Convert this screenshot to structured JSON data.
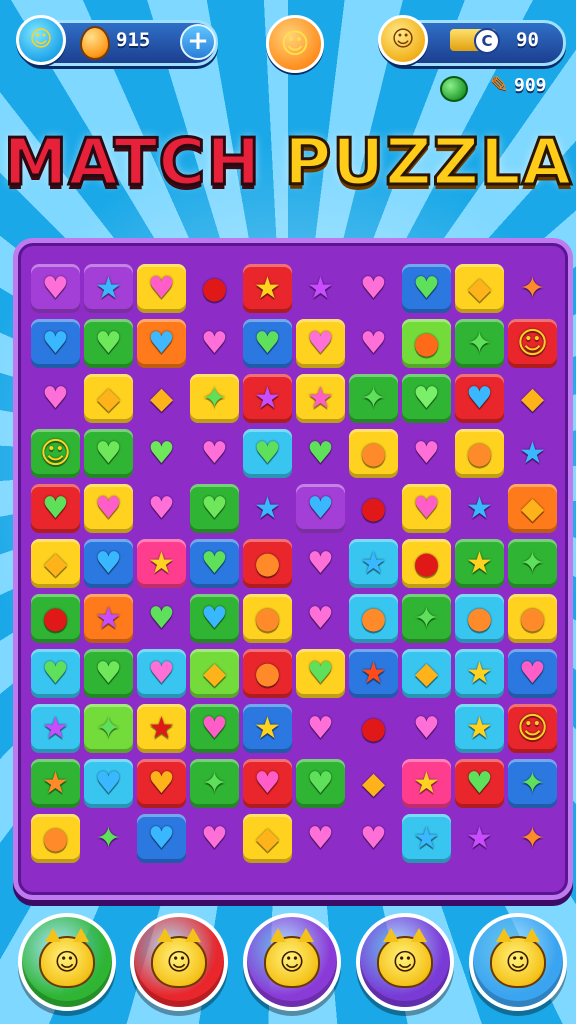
{
  "title": {
    "part1": "MATCH",
    "part2": "PUZZLA"
  },
  "hud": {
    "coins_value": "915",
    "plus_label": "+",
    "right_value": "90",
    "right_icon_label": "C",
    "carrot_count": "909"
  },
  "colors": {
    "red": "#e8262b",
    "green": "#2fb533",
    "blue": "#2b78e0",
    "yellow": "#ffd21f",
    "orange": "#ff7a1a",
    "purple": "#a33fd6",
    "lime": "#74dc3a",
    "cyan": "#38c6f0",
    "pink": "#ff3d8f"
  },
  "board": {
    "rows": [
      [
        [
          "purple",
          "♥",
          "#ff6fd8"
        ],
        [
          "purple",
          "★",
          "#39b8ff"
        ],
        [
          "yellow",
          "♥",
          "#ff5ec8"
        ],
        [
          "none",
          "●",
          "#e01818"
        ],
        [
          "red",
          "★",
          "#ffd21f"
        ],
        [
          "none",
          "★",
          "#c84dff"
        ],
        [
          "none",
          "♥",
          "#ff6fd8"
        ],
        [
          "blue",
          "♥",
          "#5ee05a"
        ],
        [
          "yellow",
          "◆",
          "#ffb31a"
        ],
        [
          "none",
          "✦",
          "#ff8a2a"
        ]
      ],
      [
        [
          "blue",
          "♥",
          "#39b8ff"
        ],
        [
          "green",
          "♥",
          "#6ee85a"
        ],
        [
          "orange",
          "♥",
          "#3fb8ff"
        ],
        [
          "none",
          "♥",
          "#ff6fd8"
        ],
        [
          "blue",
          "♥",
          "#5ee05a"
        ],
        [
          "yellow",
          "♥",
          "#ff6fd8"
        ],
        [
          "none",
          "♥",
          "#ff6fd8"
        ],
        [
          "lime",
          "●",
          "#ff6a1a"
        ],
        [
          "green",
          "✦",
          "#5ee05a"
        ],
        [
          "red",
          "☺",
          "#ffd21f"
        ]
      ],
      [
        [
          "none",
          "♥",
          "#ff6fd8"
        ],
        [
          "yellow",
          "◆",
          "#ffb31a"
        ],
        [
          "none",
          "◆",
          "#ffb31a"
        ],
        [
          "yellow",
          "✦",
          "#5ee05a"
        ],
        [
          "red",
          "★",
          "#c84dff"
        ],
        [
          "yellow",
          "★",
          "#ff5ec8"
        ],
        [
          "green",
          "✦",
          "#5ee05a"
        ],
        [
          "green",
          "♥",
          "#7af06a"
        ],
        [
          "red",
          "♥",
          "#39b8ff"
        ],
        [
          "none",
          "◆",
          "#ffb31a"
        ]
      ],
      [
        [
          "green",
          "☺",
          "#ffd21f"
        ],
        [
          "green",
          "♥",
          "#6ee85a"
        ],
        [
          "none",
          "♥",
          "#6ee85a"
        ],
        [
          "none",
          "♥",
          "#ff6fd8"
        ],
        [
          "cyan",
          "♥",
          "#5ee05a"
        ],
        [
          "none",
          "♥",
          "#5ee05a"
        ],
        [
          "yellow",
          "●",
          "#ff8a2a"
        ],
        [
          "none",
          "♥",
          "#ff6fd8"
        ],
        [
          "yellow",
          "●",
          "#ff8a2a"
        ],
        [
          "none",
          "★",
          "#39b8ff"
        ]
      ],
      [
        [
          "red",
          "♥",
          "#5ee05a"
        ],
        [
          "yellow",
          "♥",
          "#ff5ec8"
        ],
        [
          "none",
          "♥",
          "#ff6fd8"
        ],
        [
          "green",
          "♥",
          "#6ee85a"
        ],
        [
          "none",
          "★",
          "#39b8ff"
        ],
        [
          "purple",
          "♥",
          "#39b8ff"
        ],
        [
          "none",
          "●",
          "#e01818"
        ],
        [
          "yellow",
          "♥",
          "#ff5ec8"
        ],
        [
          "none",
          "★",
          "#39b8ff"
        ],
        [
          "orange",
          "◆",
          "#ffb31a"
        ]
      ],
      [
        [
          "yellow",
          "◆",
          "#ffb31a"
        ],
        [
          "blue",
          "♥",
          "#39b8ff"
        ],
        [
          "pink",
          "★",
          "#ffd21f"
        ],
        [
          "blue",
          "♥",
          "#5ee05a"
        ],
        [
          "red",
          "●",
          "#ff8a2a"
        ],
        [
          "none",
          "♥",
          "#ff6fd8"
        ],
        [
          "cyan",
          "★",
          "#39b8ff"
        ],
        [
          "yellow",
          "●",
          "#e01818"
        ],
        [
          "green",
          "★",
          "#ffd21f"
        ],
        [
          "green",
          "✦",
          "#5ee05a"
        ]
      ],
      [
        [
          "green",
          "●",
          "#e01818"
        ],
        [
          "orange",
          "★",
          "#c84dff"
        ],
        [
          "none",
          "♥",
          "#5ee05a"
        ],
        [
          "green",
          "♥",
          "#39b8ff"
        ],
        [
          "yellow",
          "●",
          "#ff8a2a"
        ],
        [
          "none",
          "♥",
          "#ff6fd8"
        ],
        [
          "cyan",
          "●",
          "#ff8a2a"
        ],
        [
          "green",
          "✦",
          "#5ee05a"
        ],
        [
          "cyan",
          "●",
          "#ff8a2a"
        ],
        [
          "yellow",
          "●",
          "#ff8a2a"
        ]
      ],
      [
        [
          "cyan",
          "♥",
          "#5ee05a"
        ],
        [
          "green",
          "♥",
          "#6ee85a"
        ],
        [
          "cyan",
          "♥",
          "#ff6fd8"
        ],
        [
          "lime",
          "◆",
          "#ffb31a"
        ],
        [
          "red",
          "●",
          "#ff8a2a"
        ],
        [
          "yellow",
          "♥",
          "#5ee05a"
        ],
        [
          "blue",
          "★",
          "#ff4a1a"
        ],
        [
          "cyan",
          "◆",
          "#ffb31a"
        ],
        [
          "cyan",
          "★",
          "#ffd21f"
        ],
        [
          "blue",
          "♥",
          "#ff5ec8"
        ]
      ],
      [
        [
          "cyan",
          "★",
          "#c84dff"
        ],
        [
          "lime",
          "✦",
          "#5ee05a"
        ],
        [
          "yellow",
          "★",
          "#e01818"
        ],
        [
          "green",
          "♥",
          "#ff5ec8"
        ],
        [
          "blue",
          "★",
          "#ffd21f"
        ],
        [
          "none",
          "♥",
          "#ff6fd8"
        ],
        [
          "none",
          "●",
          "#e01818"
        ],
        [
          "none",
          "♥",
          "#ff6fd8"
        ],
        [
          "cyan",
          "★",
          "#ffd21f"
        ],
        [
          "red",
          "☺",
          "#ffd21f"
        ]
      ],
      [
        [
          "green",
          "★",
          "#ff8a2a"
        ],
        [
          "cyan",
          "♥",
          "#39b8ff"
        ],
        [
          "red",
          "♥",
          "#ffb31a"
        ],
        [
          "green",
          "✦",
          "#5ee05a"
        ],
        [
          "red",
          "♥",
          "#ff5ec8"
        ],
        [
          "green",
          "♥",
          "#5ee05a"
        ],
        [
          "none",
          "◆",
          "#ffb31a"
        ],
        [
          "pink",
          "★",
          "#ffd21f"
        ],
        [
          "red",
          "♥",
          "#5ee05a"
        ],
        [
          "blue",
          "✦",
          "#5ee05a"
        ]
      ],
      [
        [
          "yellow",
          "●",
          "#ff8a2a"
        ],
        [
          "none",
          "✦",
          "#5ee05a"
        ],
        [
          "blue",
          "♥",
          "#39b8ff"
        ],
        [
          "none",
          "♥",
          "#ff6fd8"
        ],
        [
          "yellow",
          "◆",
          "#ffb31a"
        ],
        [
          "none",
          "♥",
          "#ff6fd8"
        ],
        [
          "none",
          "♥",
          "#ff6fd8"
        ],
        [
          "cyan",
          "★",
          "#39b8ff"
        ],
        [
          "none",
          "★",
          "#c84dff"
        ],
        [
          "none",
          "✦",
          "#ff8a2a"
        ]
      ]
    ]
  },
  "bottom_buttons": [
    {
      "name": "green-cat-button",
      "color": "#2fb533",
      "face": "☺"
    },
    {
      "name": "red-cat-button",
      "color": "#e8262b",
      "face": "☺"
    },
    {
      "name": "purple-cat-button",
      "color": "#8a3ad6",
      "face": "☺"
    },
    {
      "name": "violet-cat-button",
      "color": "#7a3ad6",
      "face": "☺"
    },
    {
      "name": "blue-cat-button",
      "color": "#3aa4f0",
      "face": "☺"
    }
  ]
}
